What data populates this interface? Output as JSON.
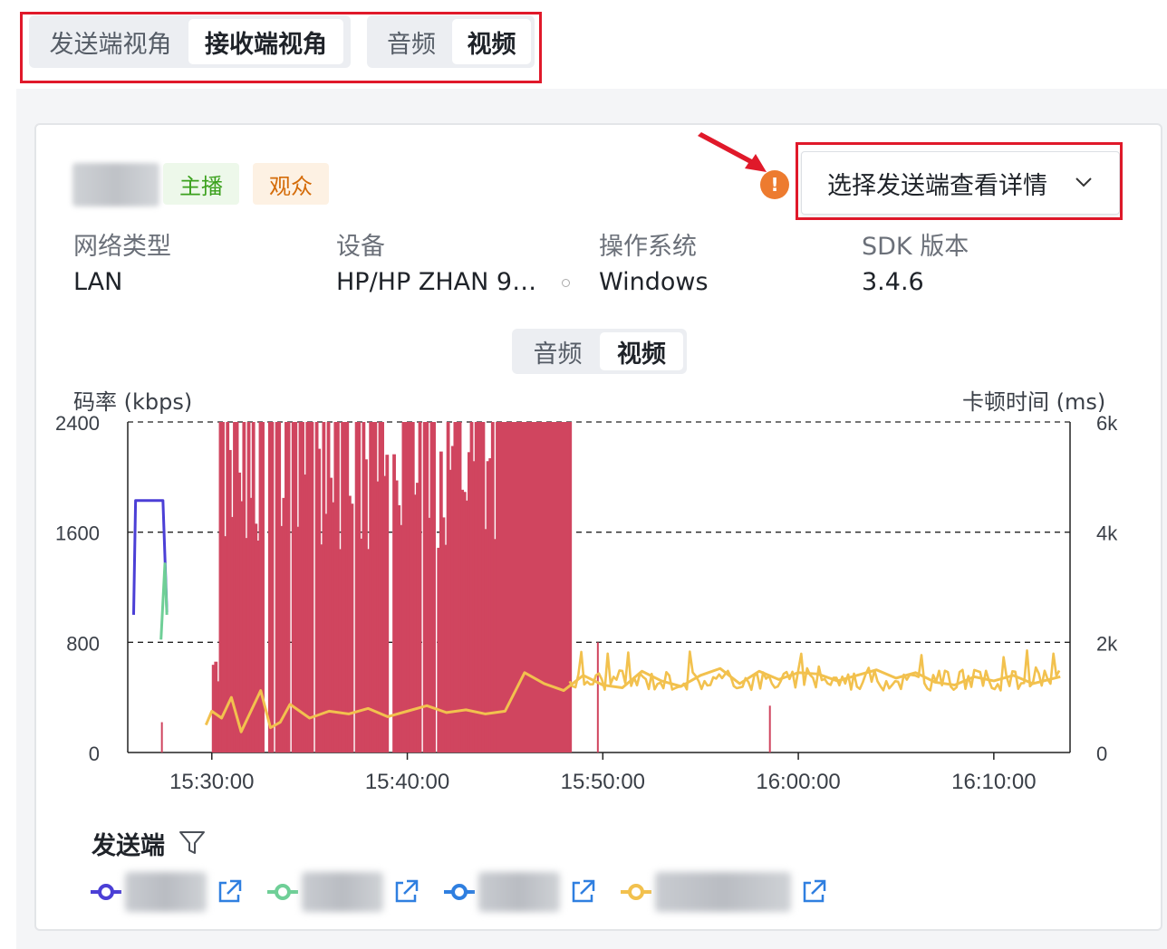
{
  "view_tabs": {
    "sender": "发送端视角",
    "receiver": "接收端视角",
    "active": "receiver"
  },
  "media_tabs": {
    "audio": "音频",
    "video": "视频",
    "active": "video"
  },
  "user": {
    "role_host": "主播",
    "role_audience": "观众"
  },
  "sender_select": {
    "label": "选择发送端查看详情",
    "warning_icon": "!"
  },
  "info": {
    "network_label": "网络类型",
    "network_value": "LAN",
    "device_label": "设备",
    "device_value": "HP/HP ZHAN 9…",
    "os_label": "操作系统",
    "os_value": "Windows",
    "sdk_label": "SDK 版本",
    "sdk_value": "3.4.6"
  },
  "chart_tabs": {
    "audio": "音频",
    "video": "视频",
    "active": "video"
  },
  "chart_data": {
    "type": "line",
    "ylabel": "码率 (kbps)",
    "y2label": "卡顿时间 (ms)",
    "ylim": [
      0,
      2400
    ],
    "y2lim": [
      0,
      6000
    ],
    "y_ticks": [
      "2400",
      "1600",
      "800",
      "0"
    ],
    "y2_ticks": [
      "6k",
      "4k",
      "2k",
      "0"
    ],
    "x_ticks": [
      "15:30:00",
      "15:40:00",
      "15:50:00",
      "16:00:00",
      "16:10:00"
    ],
    "x_range_minutes": [
      -4.3,
      43.9
    ],
    "grid": "dashed-horizontal",
    "colors": {
      "purple": "#4b3fd6",
      "green": "#6fcf97",
      "blue": "#2f7fe0",
      "yellow": "#f2c14e",
      "stall": "#d0455f"
    },
    "series": [
      {
        "color": "purple",
        "x": [
          -4,
          -3.9,
          -3.2,
          -2.5,
          -2.3
        ],
        "values": [
          1000,
          1830,
          1830,
          1830,
          1020
        ]
      },
      {
        "color": "green",
        "x": [
          -2.6,
          -2.4,
          -2.3
        ],
        "values": [
          820,
          1370,
          1000
        ]
      },
      {
        "color": "yellow",
        "x": [
          -0.3,
          0,
          0.5,
          1,
          1.5,
          2,
          2.5,
          3,
          3.5,
          4,
          5,
          6,
          7,
          8,
          9,
          10,
          11,
          12,
          13,
          14,
          15,
          16,
          17,
          18,
          19,
          20,
          21,
          22,
          23,
          24,
          25,
          26,
          27,
          28,
          29,
          30,
          31,
          32,
          33,
          34,
          35,
          36,
          37,
          38,
          39,
          40,
          41,
          42,
          43.4
        ],
        "values": [
          200,
          300,
          250,
          400,
          150,
          300,
          450,
          180,
          220,
          350,
          250,
          300,
          280,
          320,
          260,
          300,
          340,
          290,
          310,
          280,
          300,
          580,
          500,
          450,
          560,
          490,
          470,
          590,
          520,
          480,
          560,
          610,
          500,
          590,
          530,
          580,
          570,
          520,
          560,
          600,
          540,
          580,
          510,
          490,
          550,
          520,
          560,
          500,
          550
        ]
      }
    ],
    "stall_bars_note": "red bars for stall time (ms) on right axis, dense between 15:30 and 15:48"
  },
  "sender_section": {
    "title": "发送端"
  },
  "legend": [
    {
      "color": "purple"
    },
    {
      "color": "green"
    },
    {
      "color": "blue"
    },
    {
      "color": "yellow"
    }
  ]
}
